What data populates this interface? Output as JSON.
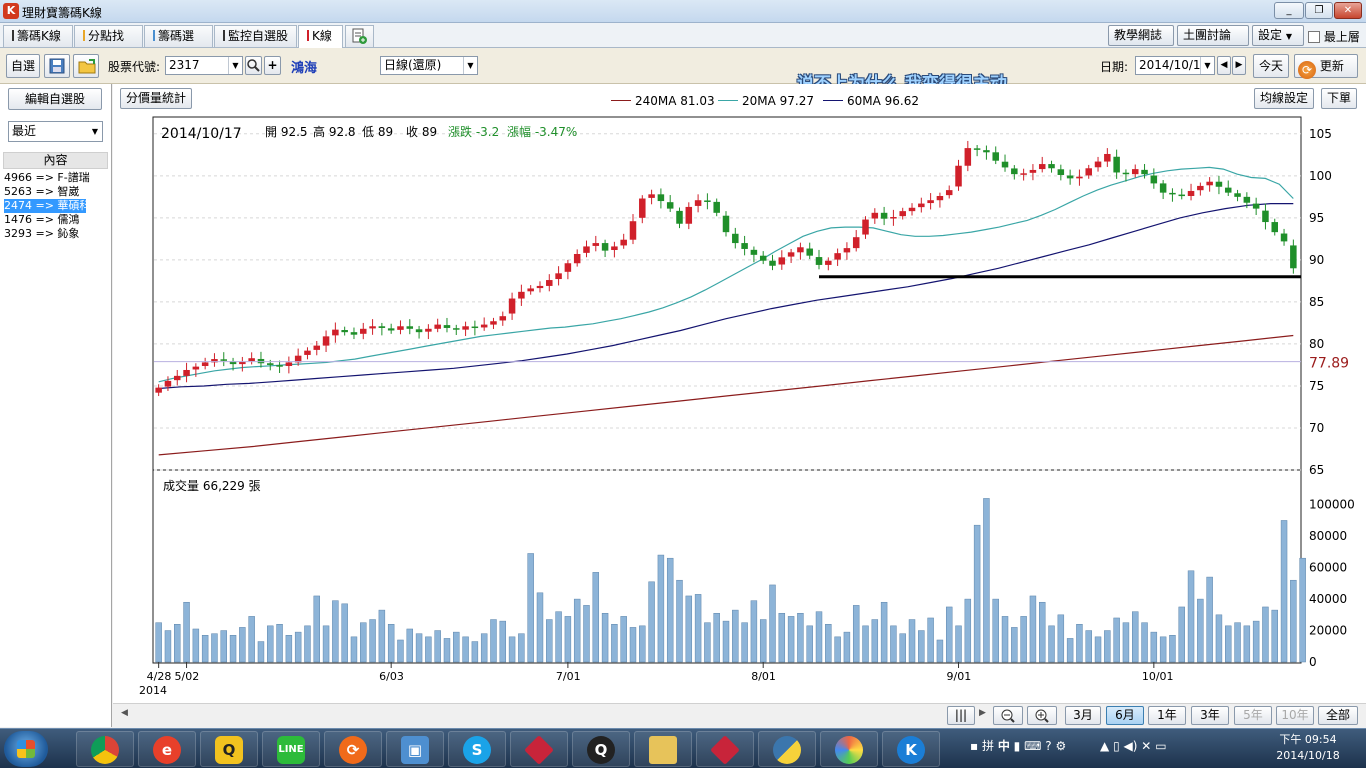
{
  "window": {
    "title": "理財寶籌碼K線",
    "icon_letter": "K",
    "minimize": "_",
    "restore": "❐",
    "close": "✕"
  },
  "tabs": [
    "籌碼K線",
    "分點找股",
    "籌碼選股",
    "監控自選股",
    "K線"
  ],
  "tab_extra_icon": "add-tab-icon",
  "right_buttons": {
    "teach": "教學網誌",
    "forum": "土團討論",
    "forum_badge": "9+",
    "settings": "設定",
    "topmost": "最上層"
  },
  "toolbar": {
    "self_select": "自選",
    "stock_code_label": "股票代號:",
    "stock_code": "2317",
    "stock_name": "鴻海",
    "period": "日線(還原)",
    "date_label": "日期:",
    "date": "2014/10/1",
    "today": "今天",
    "refresh": "更新",
    "overlay_text": "说不上为什么  我变得很主动"
  },
  "sidebar": {
    "edit_button": "編輯自選股",
    "filter": "最近",
    "header": "內容",
    "items": [
      "4966 => F-譜瑞",
      "5263 => 智崴",
      "2474 => 華碩科",
      "1476 => 儒鴻",
      "3293 => 鈊象"
    ],
    "selected_index": 2
  },
  "chart_controls": {
    "volume_stats": "分價量統計",
    "ma_settings": "均線設定",
    "place_order": "下單"
  },
  "legend": [
    {
      "label": "240MA 81.03",
      "color": "#8b1c1c"
    },
    {
      "label": "20MA 97.27",
      "color": "#3aa6a6"
    },
    {
      "label": "60MA 96.62",
      "color": "#141470"
    }
  ],
  "info_bar": {
    "date": "2014/10/17",
    "open": "開 92.5",
    "high": "高 92.8",
    "low": "低 89",
    "close": "收 89",
    "change": "漲跌 -3.2",
    "change_pct": "漲幅  -3.47%"
  },
  "price_axis": [
    "105",
    "100",
    "95",
    "90",
    "85",
    "80",
    "75",
    "70",
    "65"
  ],
  "cursor_price": "77.89",
  "volume_label": "成交量 66,229 張",
  "volume_axis": [
    "100000",
    "80000",
    "60000",
    "40000",
    "20000",
    "0"
  ],
  "x_axis": [
    "4/28",
    "5/02",
    "6/03",
    "7/01",
    "8/01",
    "9/01",
    "10/01"
  ],
  "x_axis_year": "2014",
  "period_buttons": [
    "3月",
    "6月",
    "1年",
    "3年",
    "5年",
    "10年",
    "全部"
  ],
  "period_active": "6月",
  "clock": {
    "time": "下午 09:54",
    "date": "2014/10/18"
  },
  "tray": {
    "ime": "中"
  },
  "colors": {
    "up": "#d0202a",
    "down": "#1f8f2a",
    "volume": "#8db4d8",
    "support_line": "#000000"
  },
  "chart_data": {
    "type": "candlestick",
    "x_range": [
      "2014-04-28",
      "2014-10-17"
    ],
    "ylim": [
      65,
      107
    ],
    "volume_ylim": [
      0,
      110000
    ],
    "support_line": 88,
    "closes": [
      74.8,
      75.6,
      76.2,
      76.9,
      77.3,
      77.8,
      78.2,
      78.0,
      77.6,
      77.9,
      78.3,
      77.7,
      77.5,
      77.3,
      77.8,
      78.6,
      79.2,
      79.8,
      80.9,
      81.7,
      81.4,
      81.1,
      81.8,
      82.1,
      81.9,
      81.6,
      82.1,
      81.8,
      81.4,
      81.8,
      82.3,
      81.9,
      81.7,
      82.1,
      81.9,
      82.3,
      82.7,
      83.3,
      85.4,
      86.2,
      86.6,
      86.9,
      87.6,
      88.4,
      89.6,
      90.7,
      91.6,
      92.0,
      91.1,
      91.6,
      92.4,
      94.6,
      97.3,
      97.8,
      97.0,
      96.1,
      94.3,
      96.3,
      97.1,
      96.9,
      95.6,
      93.3,
      92.0,
      91.3,
      90.6,
      89.9,
      89.3,
      90.3,
      90.9,
      91.5,
      90.5,
      89.4,
      89.9,
      90.8,
      91.4,
      92.7,
      94.8,
      95.6,
      94.9,
      95.1,
      95.8,
      96.2,
      96.7,
      97.1,
      97.6,
      98.3,
      101.2,
      103.3,
      103.1,
      102.8,
      101.8,
      101.0,
      100.2,
      100.3,
      100.7,
      101.4,
      100.9,
      100.1,
      99.7,
      99.9,
      100.9,
      101.7,
      102.6,
      100.4,
      100.2,
      100.8,
      100.2,
      99.1,
      98.0,
      97.8,
      97.6,
      98.2,
      98.8,
      99.3,
      98.7,
      98.0,
      97.5,
      96.8,
      96.1,
      94.5,
      93.3,
      92.2,
      89.0
    ],
    "volumes": [
      25000,
      20000,
      24000,
      38000,
      21000,
      17000,
      18000,
      20000,
      17000,
      22000,
      29000,
      13000,
      23000,
      24000,
      17000,
      19000,
      23000,
      42000,
      23000,
      39000,
      37000,
      16000,
      25000,
      27000,
      33000,
      24000,
      14000,
      21000,
      18000,
      16000,
      20000,
      15000,
      19000,
      16000,
      13000,
      18000,
      27000,
      26000,
      16000,
      18000,
      69000,
      44000,
      27000,
      32000,
      29000,
      40000,
      36000,
      57000,
      31000,
      24000,
      29000,
      22000,
      23000,
      51000,
      68000,
      66000,
      52000,
      42000,
      43000,
      25000,
      31000,
      26000,
      33000,
      25000,
      39000,
      27000,
      49000,
      31000,
      29000,
      31000,
      23000,
      32000,
      24000,
      16000,
      19000,
      36000,
      23000,
      27000,
      38000,
      23000,
      18000,
      27000,
      20000,
      28000,
      14000,
      35000,
      23000,
      40000,
      87000,
      104000,
      40000,
      29000,
      22000,
      29000,
      42000,
      38000,
      23000,
      30000,
      15000,
      24000,
      20000,
      16000,
      20000,
      28000,
      25000,
      32000,
      25000,
      19000,
      16000,
      17000,
      35000,
      58000,
      40000,
      54000,
      30000,
      23000,
      25000,
      23000,
      26000,
      35000,
      33000,
      90000,
      52000,
      66000
    ],
    "ma20": [
      75.5,
      75.9,
      76.2,
      76.5,
      76.8,
      77.0,
      77.2,
      77.3,
      77.4,
      77.5,
      77.6,
      77.7,
      77.8,
      78.0,
      78.2,
      78.5,
      78.8,
      79.1,
      79.4,
      79.7,
      80.0,
      80.3,
      80.6,
      80.9,
      81.1,
      81.3,
      81.5,
      81.7,
      81.9,
      82.0,
      82.2,
      82.4,
      82.7,
      83.0,
      83.4,
      83.8,
      84.3,
      84.9,
      85.6,
      86.4,
      87.3,
      88.2,
      89.1,
      90.0,
      91.0,
      91.9,
      92.8,
      93.4,
      93.8,
      93.9,
      93.9,
      93.8,
      93.4,
      93.0,
      92.8,
      92.8,
      92.9,
      93.1,
      93.3,
      93.6,
      93.9,
      94.3,
      94.7,
      95.3,
      96.0,
      96.8,
      97.6,
      98.3,
      98.9,
      99.4,
      99.9,
      100.3,
      100.6,
      100.8,
      100.9,
      101.0,
      100.8,
      100.2,
      99.8,
      99.7,
      99.0,
      97.3
    ],
    "ma60": [
      74.7,
      74.9,
      75.0,
      75.2,
      75.3,
      75.5,
      75.7,
      75.9,
      76.1,
      76.3,
      76.5,
      76.7,
      76.9,
      77.1,
      77.4,
      77.7,
      78.0,
      78.4,
      78.8,
      79.3,
      79.8,
      80.4,
      81.0,
      81.6,
      82.3,
      83.0,
      83.6,
      84.2,
      84.7,
      85.2,
      85.6,
      86.0,
      86.4,
      86.8,
      87.3,
      87.8,
      88.4,
      89.0,
      89.7,
      90.4,
      91.1,
      91.8,
      92.6,
      93.4,
      94.2,
      95.0,
      95.6,
      96.1,
      96.5,
      96.7,
      96.7
    ],
    "ma240": [
      66.8,
      67.3,
      67.8,
      68.4,
      69.0,
      69.6,
      70.2,
      70.8,
      71.4,
      72.0,
      72.6,
      73.2,
      73.8,
      74.4,
      75.0,
      75.6,
      76.2,
      76.8,
      77.4,
      78.0,
      78.6,
      79.2,
      79.8,
      80.4,
      81.0
    ]
  }
}
